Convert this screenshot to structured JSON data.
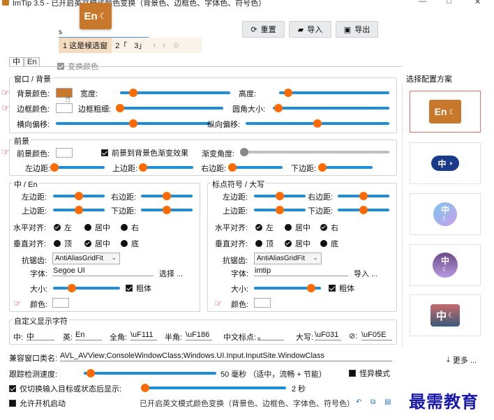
{
  "window": {
    "title": "ImTip 3.5 - 已开启英文模式颜色变换（背景色、边框色、字体色、符号色）"
  },
  "floating_badge": {
    "text": "En",
    "moon": "☾"
  },
  "toolbar": {
    "reset": "重置",
    "import": "导入",
    "export": "导出"
  },
  "ime_input": {
    "value": "s"
  },
  "candidates": {
    "items": [
      "1 这是候选窗",
      "2「",
      "3」"
    ],
    "prev": "‹",
    "next": "›",
    "emoji": "☺"
  },
  "tabs": [
    "中",
    "En"
  ],
  "transform_color_label": "变换颜色",
  "window_bg": {
    "legend": "窗口 / 背景",
    "bg_color": "背景颜色:",
    "width": "宽度:",
    "height": "高度:",
    "border_color": "边框颜色:",
    "border_width": "边框粗细:",
    "radius": "圆角大小:",
    "h_offset": "横向偏移:",
    "v_offset": "纵向偏移:",
    "bg_swatch": "#c8782a",
    "values": {
      "width": 0.12,
      "height": 0.08,
      "border_width": 0.0,
      "radius": 0.05,
      "h_offset": 0.5,
      "v_offset": 0.5
    }
  },
  "foreground": {
    "legend": "前景",
    "fg_color": "前景颜色:",
    "gradient": "前景到背景色渐变效果",
    "gradient_angle": "渐变角度:",
    "left": "左边距:",
    "top": "上边距:",
    "right": "右边距:",
    "bottom": "下边距:",
    "values": {
      "gradient_angle": 0.0,
      "left": 0.0,
      "top": 0.0,
      "right": 0.0,
      "bottom": 0.0
    }
  },
  "zh_en": {
    "legend": "中 / En",
    "left": "左边距:",
    "right": "右边距:",
    "top": "上边距:",
    "bottom": "下边距:",
    "h_align": "水平对齐:",
    "v_align": "垂直对齐:",
    "h_opts": [
      "左",
      "居中",
      "右"
    ],
    "v_opts": [
      "顶",
      "居中",
      "底"
    ],
    "aa": "抗锯齿:",
    "aa_value": "AntiAliasGridFit",
    "font": "字体:",
    "font_value": "Segoe UI",
    "choose": "选择 ...",
    "size": "大小:",
    "bold": "粗体",
    "color": "颜色:",
    "values": {
      "left": 0.5,
      "right": 0.5,
      "top": 0.5,
      "bottom": 0.5,
      "size": 0.28
    }
  },
  "punct": {
    "legend": "标点符号 / 大写",
    "left": "左边距:",
    "right": "右边距:",
    "top": "上边距:",
    "bottom": "下边距:",
    "h_align": "水平对齐:",
    "v_align": "垂直对齐:",
    "h_opts": [
      "左",
      "居中",
      "右"
    ],
    "v_opts": [
      "顶",
      "居中",
      "底"
    ],
    "aa": "抗锯齿:",
    "aa_value": "AntiAliasGridFit",
    "font": "字体:",
    "font_value": "imtip",
    "import": "导入 ...",
    "size": "大小:",
    "bold": "粗体",
    "color": "颜色:",
    "values": {
      "left": 0.5,
      "right": 0.5,
      "top": 0.5,
      "bottom": 0.5,
      "size": 0.85
    }
  },
  "custom_chars": {
    "legend": "自定义显示字符",
    "items": [
      {
        "label": "中:",
        "value": "中"
      },
      {
        "label": "英:",
        "value": "En"
      },
      {
        "label": "全角:",
        "value": "\\uF111"
      },
      {
        "label": "半角:",
        "value": "\\uF186"
      },
      {
        "label": "中文标点:",
        "value": "。"
      },
      {
        "label": "大写:",
        "value": "\\uF031"
      },
      {
        "label": "⊘:",
        "value": "\\uF05E"
      }
    ]
  },
  "compat": {
    "label": "兼容窗口类名:",
    "value": "AVL_AVView;ConsoleWindowClass;Windows.UI.Input.InputSite.WindowClass"
  },
  "tracking": {
    "label": "跟踪检测速度:",
    "value_text": "50 毫秒 （适中，流畅 + 节能）",
    "value": 0.05,
    "weird_mode": "怪异模式"
  },
  "only_show": {
    "label": "仅切换输入目标或状态后显示:",
    "value_text": "2 秒",
    "value": 0.02
  },
  "autostart": "允许开机启动",
  "status_text": "已开启英文模式颜色变换（背景色、边框色、字体色、符号色）",
  "schemes": {
    "title": "选择配置方案",
    "more": "更多 ...",
    "cards": [
      {
        "text": "En",
        "bg": "#c8782a"
      },
      {
        "text": "中",
        "bg": "#1a3a8a"
      },
      {
        "text": "中",
        "bg": "#7dc6f0"
      },
      {
        "text": "中",
        "bg": "#9a7ec8"
      },
      {
        "text": "中",
        "bg": "#c86a6a"
      }
    ]
  },
  "watermark": "最需教育"
}
